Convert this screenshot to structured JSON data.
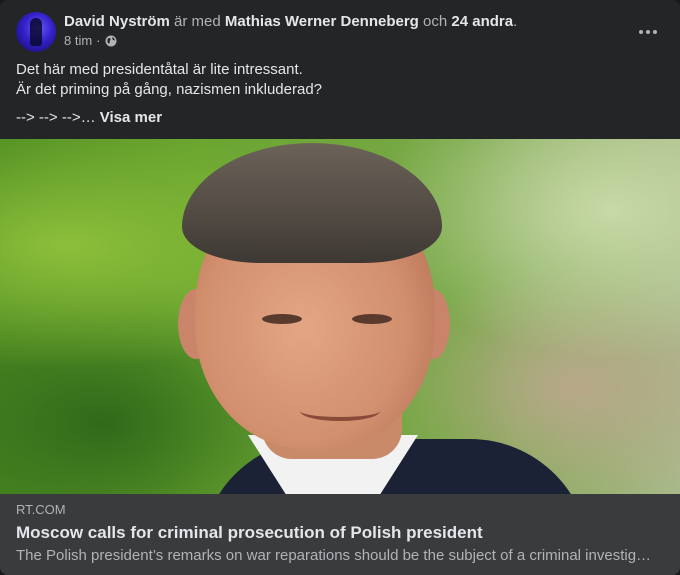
{
  "post": {
    "author_name": "David Nyström",
    "with_text": "är med",
    "tagged_name": "Mathias Werner Denneberg",
    "and_text": "och",
    "others": "24 andra",
    "period": ".",
    "time": "8 tim",
    "separator": "·",
    "privacy_icon": "globe-icon",
    "text_lines": [
      "Det här med presidentåtal är lite intressant.",
      "Är det priming på gång, nazismen inkluderad?"
    ],
    "arrows_text": "--> --> -->…",
    "see_more": "Visa mer"
  },
  "link_preview": {
    "domain": "RT.COM",
    "title": "Moscow calls for criminal prosecution of Polish president",
    "description": "The Polish president’s remarks on war reparations should be the subject of a criminal investig…"
  },
  "colors": {
    "card_bg": "#242526",
    "link_bg": "#3a3b3c",
    "primary_text": "#e4e6eb",
    "secondary_text": "#b0b3b8"
  }
}
